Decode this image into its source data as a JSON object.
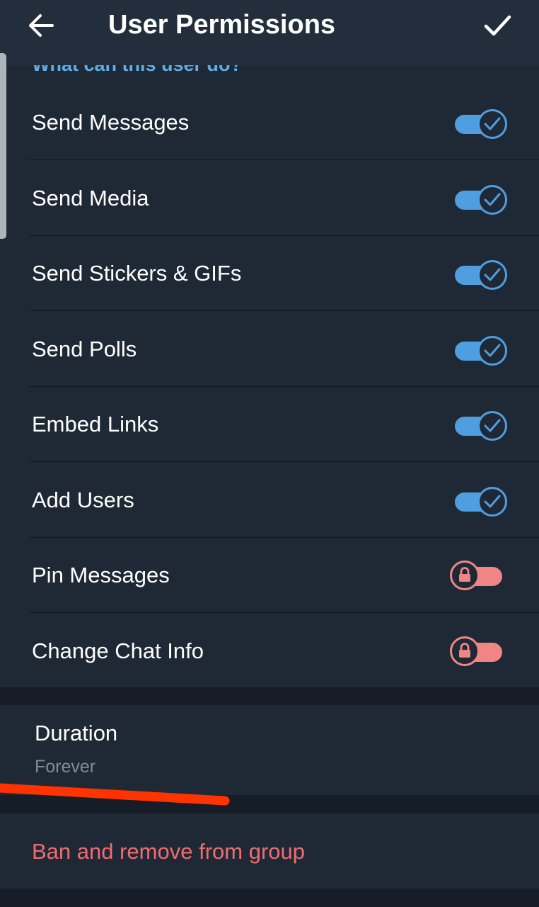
{
  "header": {
    "title": "User Permissions",
    "back_icon": "arrow-left-icon",
    "done_icon": "checkmark-icon"
  },
  "permissions": {
    "section_title": "What can this user do?",
    "items": [
      {
        "label": "Send Messages",
        "enabled": true,
        "locked": false
      },
      {
        "label": "Send Media",
        "enabled": true,
        "locked": false
      },
      {
        "label": "Send Stickers & GIFs",
        "enabled": true,
        "locked": false
      },
      {
        "label": "Send Polls",
        "enabled": true,
        "locked": false
      },
      {
        "label": "Embed Links",
        "enabled": true,
        "locked": false
      },
      {
        "label": "Add Users",
        "enabled": true,
        "locked": false
      },
      {
        "label": "Pin Messages",
        "enabled": false,
        "locked": true
      },
      {
        "label": "Change Chat Info",
        "enabled": false,
        "locked": true
      }
    ]
  },
  "duration": {
    "label": "Duration",
    "value": "Forever"
  },
  "ban": {
    "label": "Ban and remove from group"
  },
  "colors": {
    "background": "#1f2936",
    "header": "#232e3c",
    "accent": "#4f9ee0",
    "locked": "#ef8684",
    "danger": "#ef6c70",
    "annotation": "#ff3300"
  }
}
